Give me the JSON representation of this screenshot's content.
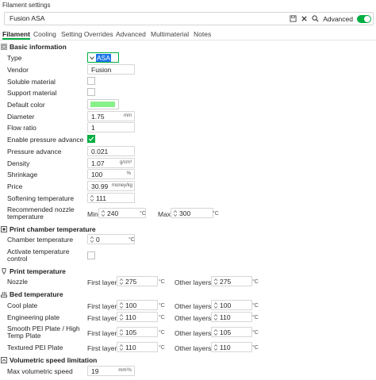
{
  "window": {
    "title": "Filament settings"
  },
  "preset": {
    "name": "Fusion ASA",
    "advanced_label": "Advanced",
    "advanced_on": true
  },
  "tabs": [
    "Filament",
    "Cooling",
    "Setting Overrides",
    "Advanced",
    "Multimaterial",
    "Notes"
  ],
  "sections": {
    "basic": "Basic information",
    "chamber": "Print chamber temperature",
    "print_temp": "Print temperature",
    "bed": "Bed temperature",
    "volumetric": "Volumetric speed limitation"
  },
  "basic": {
    "type_label": "Type",
    "type_value": "ASA",
    "vendor_label": "Vendor",
    "vendor_value": "Fusion",
    "soluble_label": "Soluble material",
    "soluble": false,
    "support_label": "Support material",
    "support": false,
    "color_label": "Default color",
    "color_value": "#88f088",
    "diameter_label": "Diameter",
    "diameter_value": "1.75",
    "diameter_unit": "mm",
    "flow_label": "Flow ratio",
    "flow_value": "1",
    "epa_label": "Enable pressure advance",
    "epa": true,
    "pa_label": "Pressure advance",
    "pa_value": "0.021",
    "density_label": "Density",
    "density_value": "1.07",
    "density_unit": "g/cm³",
    "shrink_label": "Shrinkage",
    "shrink_value": "100",
    "shrink_unit": "%",
    "price_label": "Price",
    "price_value": "30.99",
    "price_unit": "money/kg",
    "soft_label": "Softening temperature",
    "soft_value": "111",
    "rnt_label_1": "Recommended nozzle",
    "rnt_label_2": "temperature",
    "min_label": "Min",
    "min_value": "240",
    "max_label": "Max",
    "max_value": "300",
    "temp_unit": "°C"
  },
  "chamber": {
    "temp_label": "Chamber temperature",
    "temp_value": "0",
    "activate_label_1": "Activate temperature",
    "activate_label_2": "control",
    "activate": false
  },
  "print_temp": {
    "nozzle_label": "Nozzle",
    "first_layer": "275",
    "other_layers": "275"
  },
  "layer_labels": {
    "first": "First layer",
    "other": "Other layers"
  },
  "bed": {
    "cool_label": "Cool plate",
    "cool_first": "100",
    "cool_other": "100",
    "eng_label": "Engineering plate",
    "eng_first": "110",
    "eng_other": "110",
    "pei_label_1": "Smooth PEI Plate / High",
    "pei_label_2": "Temp Plate",
    "pei_first": "105",
    "pei_other": "105",
    "tex_label": "Textured PEI Plate",
    "tex_first": "110",
    "tex_other": "110"
  },
  "volumetric": {
    "max_label": "Max volumetric speed",
    "max_value": "19",
    "max_unit": "mm³/s"
  },
  "colors": {
    "accent": "#00ae42",
    "selection": "#1a73e8"
  }
}
